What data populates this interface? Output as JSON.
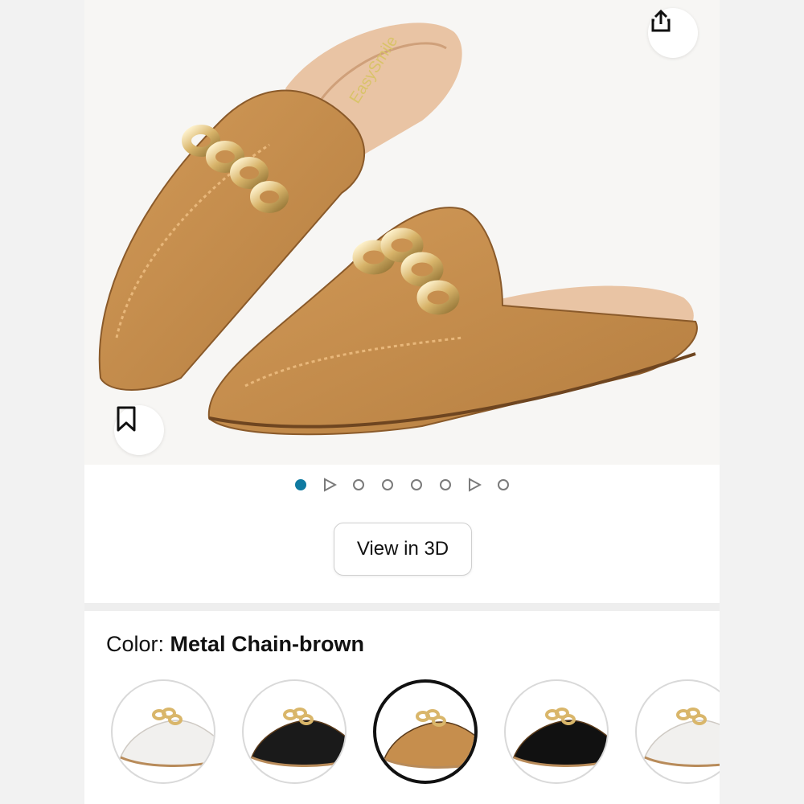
{
  "hero": {
    "brand_text": "EasySmile",
    "share_icon": "share-icon",
    "save_icon": "bookmark-icon"
  },
  "carousel": {
    "indicators": [
      "image",
      "video",
      "image",
      "image",
      "image",
      "image",
      "video",
      "image"
    ],
    "active_index": 0
  },
  "view3d": {
    "label": "View in 3D"
  },
  "color": {
    "label": "Color: ",
    "value": "Metal Chain-brown"
  },
  "swatches": {
    "items": [
      "white",
      "black",
      "brown",
      "black-patent",
      "white"
    ],
    "selected_index": 2
  },
  "colors": {
    "accent": "#0f7aa1",
    "shoe_brown": "#c68e4d",
    "gold": "#d9b66a"
  }
}
